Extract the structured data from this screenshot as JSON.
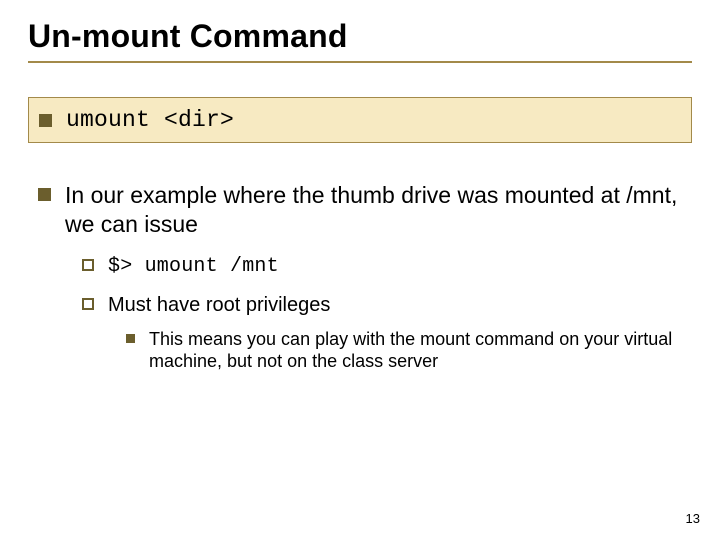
{
  "title": "Un-mount Command",
  "callout": {
    "command": "umount <dir>"
  },
  "main": {
    "intro": "In our example where the thumb drive was mounted at /mnt, we can issue",
    "sub": {
      "cmd": "$> umount /mnt",
      "priv": "Must have root privileges",
      "note": "This means you can play with the mount command on your virtual machine, but not on the class server"
    }
  },
  "page_number": "13"
}
